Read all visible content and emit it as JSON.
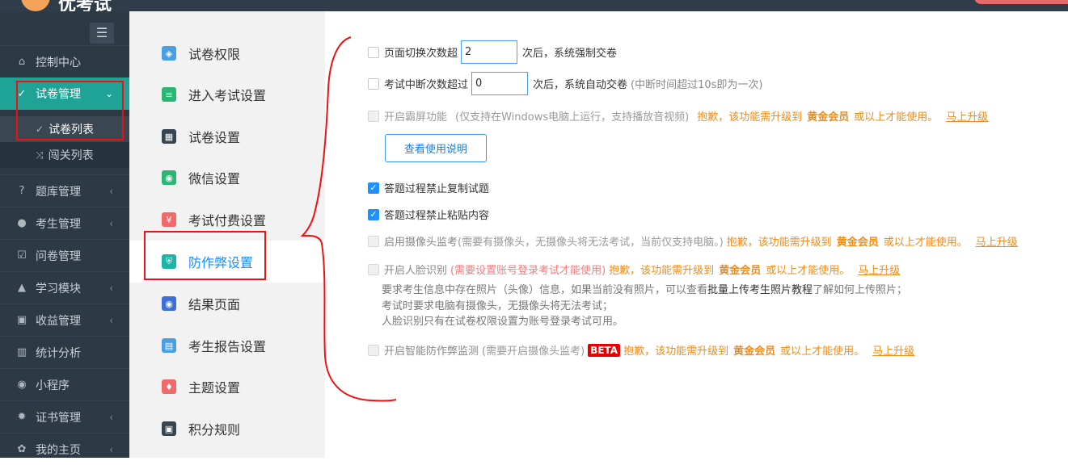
{
  "app": {
    "logo_text": "优考试"
  },
  "sidebar": {
    "items": [
      {
        "label": "控制中心",
        "icon": "home-icon"
      },
      {
        "label": "试卷管理",
        "icon": "check-circle-icon"
      },
      {
        "label": "题库管理",
        "icon": "question-icon"
      },
      {
        "label": "考生管理",
        "icon": "user-icon"
      },
      {
        "label": "问卷管理",
        "icon": "checkbox-icon"
      },
      {
        "label": "学习模块",
        "icon": "graduation-icon"
      },
      {
        "label": "收益管理",
        "icon": "money-icon"
      },
      {
        "label": "统计分析",
        "icon": "bar-chart-icon"
      },
      {
        "label": "小程序",
        "icon": "wechat-icon"
      },
      {
        "label": "证书管理",
        "icon": "gear-icon"
      },
      {
        "label": "我的主页",
        "icon": "leaf-icon"
      }
    ],
    "sub_items": [
      {
        "label": "试卷列表",
        "icon": "check-circle-icon"
      },
      {
        "label": "闯关列表",
        "icon": "shuffle-icon"
      }
    ]
  },
  "midnav": {
    "items": [
      {
        "label": "试卷权限",
        "icon": "shield-lock-icon",
        "color": "#4a9fe0"
      },
      {
        "label": "进入考试设置",
        "icon": "doc-icon",
        "color": "#2bb673"
      },
      {
        "label": "试卷设置",
        "icon": "grid-icon",
        "color": "#36454f"
      },
      {
        "label": "微信设置",
        "icon": "wechat-icon",
        "color": "#2bb673"
      },
      {
        "label": "考试付费设置",
        "icon": "yen-icon",
        "color": "#f06a6a"
      },
      {
        "label": "防作弊设置",
        "icon": "shield-icon",
        "color": "#1fb3a8"
      },
      {
        "label": "结果页面",
        "icon": "eye-icon",
        "color": "#3f6fd4"
      },
      {
        "label": "考生报告设置",
        "icon": "report-icon",
        "color": "#4a9fe0"
      },
      {
        "label": "主题设置",
        "icon": "shirt-icon",
        "color": "#f06a6a"
      },
      {
        "label": "积分规则",
        "icon": "calendar-icon",
        "color": "#36454f"
      }
    ]
  },
  "settings": {
    "page_switch": {
      "label": "页面切换次数超",
      "value": "2",
      "suffix": "次后，系统强制交卷"
    },
    "interrupt": {
      "label": "考试中断次数超过",
      "value": "0",
      "suffix": "次后，系统自动交卷",
      "note": "(中断时间超过10s即为一次)"
    },
    "fullscreen": {
      "label": "开启霸屏功能",
      "note": "(仅支持在Windows电脑上运行，支持播放音视频)"
    },
    "upgrade": {
      "sorry": "抱歉，该功能需升级到",
      "tier": "黄金会员",
      "tail": "或以上才能使用。",
      "link": "马上升级"
    },
    "manual_button": "查看使用说明",
    "no_copy": "答题过程禁止复制试题",
    "no_paste": "答题过程禁止粘贴内容",
    "camera": {
      "label": "启用摄像头监考",
      "note": "(需要有摄像头，无摄像头将无法考试，当前仅支持电脑。)"
    },
    "face": {
      "label": "开启人脸识别",
      "note": "(需要设置账号登录考试才能使用)"
    },
    "face_notes": {
      "line1_a": "要求考生信息中存在照片（头像）信息，如果当前没有照片，可以查看",
      "line1_b": "批量上传考生照片教程",
      "line1_c": "了解如何上传照片；",
      "line2": "考试时要求电脑有摄像头，无摄像头将无法考试；",
      "line3": "人脸识别只有在试卷权限设置为账号登录考试可用。"
    },
    "smart": {
      "label": "开启智能防作弊监测",
      "note": "(需要开启摄像头监考)",
      "badge": "BETA"
    }
  }
}
